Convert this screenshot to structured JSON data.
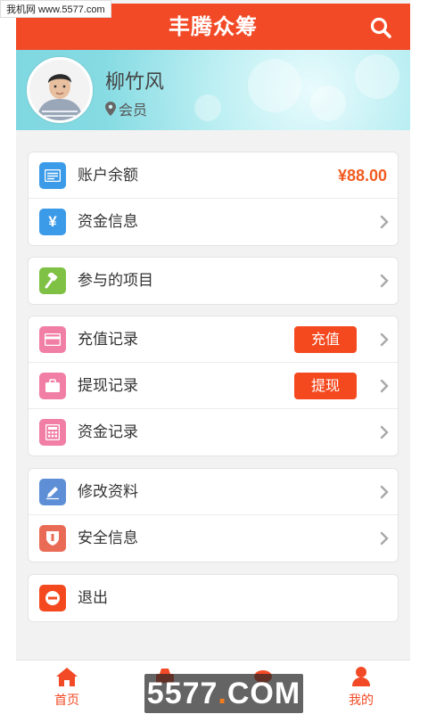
{
  "watermark_top": "我机网 www.5577.com",
  "header": {
    "title": "丰腾众筹"
  },
  "profile": {
    "name": "柳竹风",
    "role": "会员"
  },
  "groups": [
    {
      "items": [
        {
          "label": "账户余额",
          "value": "¥88.00",
          "icon": "wallet-icon",
          "color": "#3c9be8"
        },
        {
          "label": "资金信息",
          "icon": "yen-icon",
          "color": "#3c9be8"
        }
      ]
    },
    {
      "items": [
        {
          "label": "参与的项目",
          "icon": "gavel-icon",
          "color": "#7ec144"
        }
      ]
    },
    {
      "items": [
        {
          "label": "充值记录",
          "button": "充值",
          "icon": "card-icon",
          "color": "#f07ea5"
        },
        {
          "label": "提现记录",
          "button": "提现",
          "icon": "briefcase-icon",
          "color": "#f07ea5"
        },
        {
          "label": "资金记录",
          "icon": "calculator-icon",
          "color": "#f07ea5"
        }
      ]
    },
    {
      "items": [
        {
          "label": "修改资料",
          "icon": "pencil-icon",
          "color": "#5e8fd6"
        },
        {
          "label": "安全信息",
          "icon": "shield-icon",
          "color": "#ea6b55"
        }
      ]
    },
    {
      "items": [
        {
          "label": "退出",
          "icon": "logout-icon",
          "color": "#f4491f"
        }
      ]
    }
  ],
  "tabbar": {
    "home": "首页",
    "mine": "我的"
  },
  "watermark_bottom": {
    "part1": "5577",
    "dot": ".",
    "part2": "COM"
  },
  "colors": {
    "brand": "#f24a26",
    "accent_amount": "#f25b20"
  }
}
